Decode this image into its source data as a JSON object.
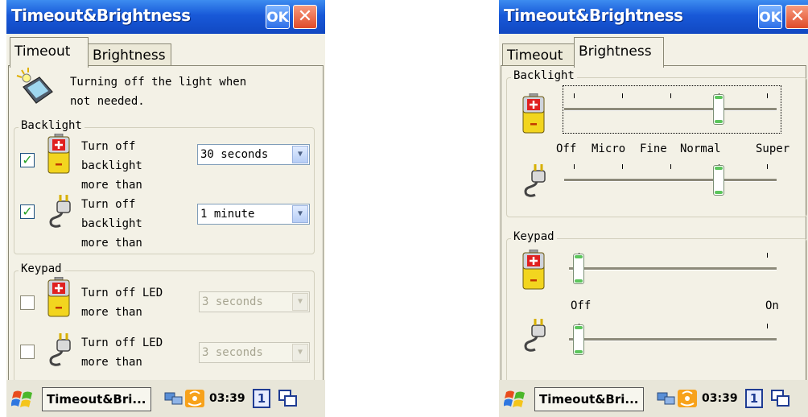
{
  "colors": {
    "titlebar": "#1859d8",
    "checkbox_check": "#21a121",
    "slider_accent": "#5cc55c",
    "panel_bg": "#f3f1e6"
  },
  "left": {
    "window_title": "Timeout&Brightness",
    "ok_label": "OK",
    "close_glyph": "✕",
    "tabs": {
      "timeout": "Timeout",
      "brightness": "Brightness"
    },
    "intro_line1": "Turning off the light when",
    "intro_line2": "not needed.",
    "backlight": {
      "label": "Backlight",
      "battery": {
        "checked": true,
        "check": "✓",
        "line1": "Turn off",
        "line2": "backlight",
        "line3": "more than",
        "value": "30 seconds"
      },
      "ac": {
        "checked": true,
        "check": "✓",
        "line1": "Turn off",
        "line2": "backlight",
        "line3": "more than",
        "value": "1 minute"
      }
    },
    "keypad": {
      "label": "Keypad",
      "battery": {
        "checked": false,
        "line1": "Turn off LED",
        "line2": "more than",
        "value": "3 seconds"
      },
      "ac": {
        "checked": false,
        "line1": "Turn off LED",
        "line2": "more than",
        "value": "3 seconds"
      }
    },
    "taskbar": {
      "app": "Timeout&Bri...",
      "time": "03:39",
      "num": "1"
    }
  },
  "right": {
    "window_title": "Timeout&Brightness",
    "ok_label": "OK",
    "close_glyph": "✕",
    "tabs": {
      "timeout": "Timeout",
      "brightness": "Brightness"
    },
    "backlight": {
      "label": "Backlight",
      "levels": [
        "Off",
        "Micro",
        "Fine",
        "Normal",
        "Super"
      ],
      "battery_level": "Normal",
      "ac_level": "Normal"
    },
    "keypad": {
      "label": "Keypad",
      "min_label": "Off",
      "max_label": "On",
      "battery_level": "Off",
      "ac_level": "Off"
    },
    "taskbar": {
      "app": "Timeout&Bri...",
      "time": "03:39",
      "num": "1"
    }
  },
  "icons": [
    "start-flag-icon",
    "light-bulb-pda-icon",
    "battery-icon",
    "plug-icon",
    "network-icon",
    "wireless-icon",
    "switch-window-icon"
  ],
  "combo_arrow": "▼"
}
